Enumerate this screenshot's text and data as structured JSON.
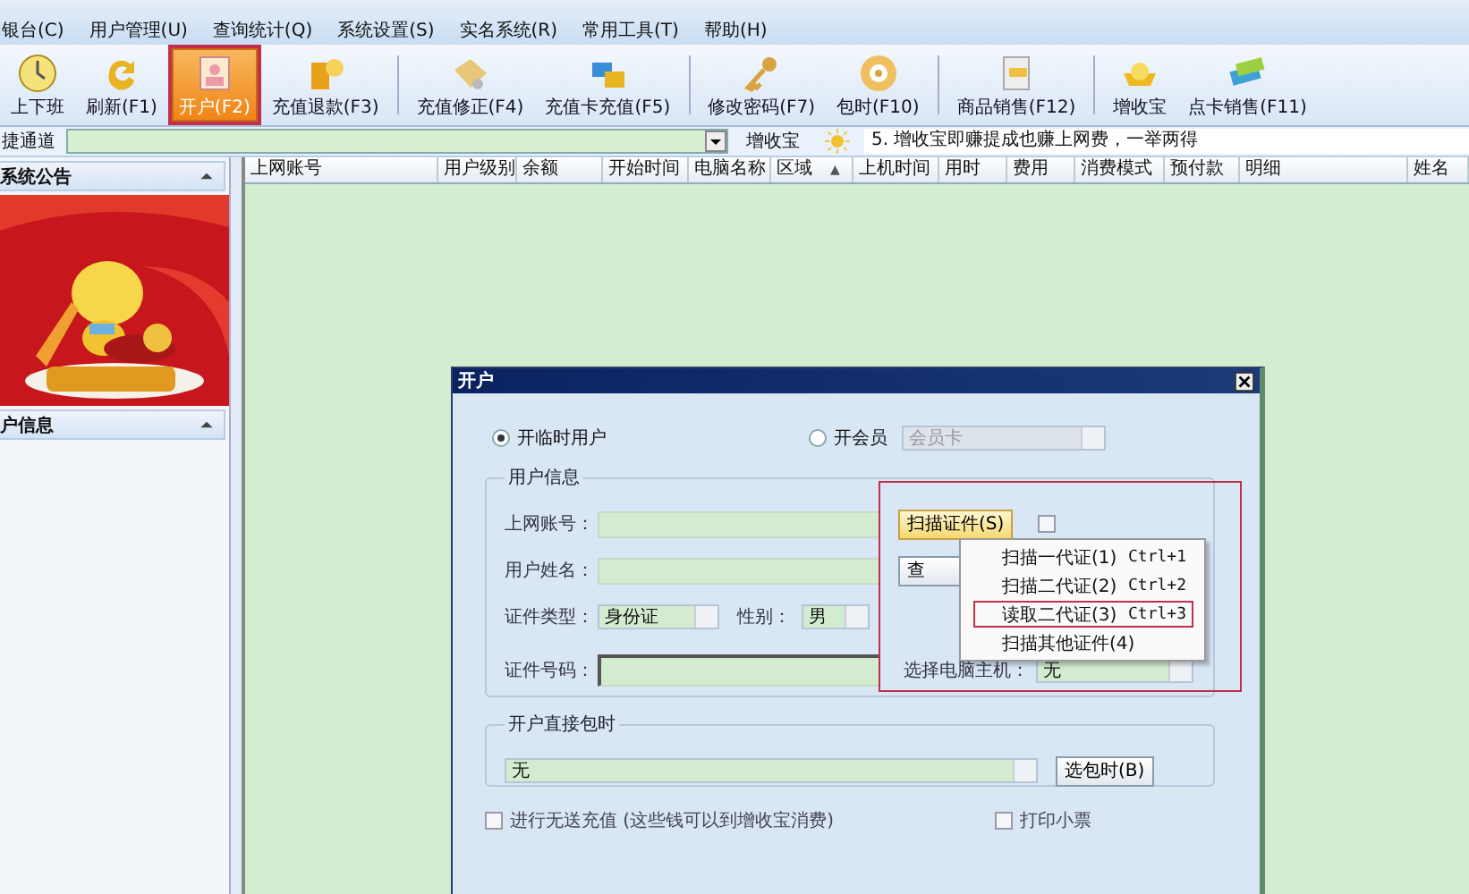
{
  "menu_bar": [
    "银台(C)",
    "用户管理(U)",
    "查询统计(Q)",
    "系统设置(S)",
    "实名系统(R)",
    "常用工具(T)",
    "帮助(H)"
  ],
  "toolbar": [
    {
      "label": "上下班",
      "selected": false,
      "marked": false,
      "separator": false
    },
    {
      "label": "刷新(F1)",
      "selected": false,
      "marked": false,
      "separator": false
    },
    {
      "label": "开户(F2)",
      "selected": true,
      "marked": true,
      "separator": false
    },
    {
      "label": "充值退款(F3)",
      "selected": false,
      "marked": false,
      "separator": false
    },
    {
      "label": "充值修正(F4)",
      "selected": false,
      "marked": false,
      "separator": true
    },
    {
      "label": "充值卡充值(F5)",
      "selected": false,
      "marked": false,
      "separator": false
    },
    {
      "label": "修改密码(F7)",
      "selected": false,
      "marked": false,
      "separator": true
    },
    {
      "label": "包时(F10)",
      "selected": false,
      "marked": false,
      "separator": false
    },
    {
      "label": "商品销售(F12)",
      "selected": false,
      "marked": false,
      "separator": true
    },
    {
      "label": "增收宝",
      "selected": false,
      "marked": false,
      "separator": true
    },
    {
      "label": "点卡销售(F11)",
      "selected": false,
      "marked": false,
      "separator": false
    }
  ],
  "quick_bar": {
    "label": "捷通道",
    "promo": "增收宝",
    "notice": "5. 增收宝即赚提成也赚上网费，一举两得"
  },
  "sidebar": {
    "sections": [
      {
        "title": "系统公告",
        "expanded": true
      },
      {
        "title": "户信息",
        "expanded": true
      }
    ]
  },
  "table": {
    "columns": [
      {
        "label": "上网账号"
      },
      {
        "label": "用户级别"
      },
      {
        "label": "余额"
      },
      {
        "label": "开始时间"
      },
      {
        "label": "电脑名称"
      },
      {
        "label": "区域",
        "sort": "▲"
      },
      {
        "label": "上机时间"
      },
      {
        "label": "用时"
      },
      {
        "label": "费用"
      },
      {
        "label": "消费模式"
      },
      {
        "label": "预付款"
      },
      {
        "label": "明细"
      },
      {
        "label": "姓名"
      }
    ]
  },
  "dialog": {
    "title": "开户",
    "account_type": [
      {
        "label": "开临时用户",
        "selected": true
      },
      {
        "label": "开会员",
        "selected": false,
        "combo": {
          "value": "会员卡",
          "disabled": true
        }
      }
    ],
    "user_info": {
      "legend": "用户信息",
      "marked": true,
      "account": {
        "label": "上网账号："
      },
      "name": {
        "label": "用户姓名："
      },
      "id_type": {
        "label": "证件类型：",
        "value": "身份证"
      },
      "gender": {
        "label": "性别：",
        "value": "男"
      },
      "id_number": {
        "label": "证件号码："
      },
      "scan_button": {
        "label": "扫描证件(S)",
        "highlighted": true
      },
      "query_button": {
        "label": "查"
      },
      "auto_account": {
        "checked": false
      },
      "host": {
        "label": "选择电脑主机：",
        "value": "无"
      }
    },
    "scan_menu": [
      {
        "label": "扫描一代证(1)",
        "shortcut": "Ctrl+1",
        "marked": false
      },
      {
        "label": "扫描二代证(2)",
        "shortcut": "Ctrl+2",
        "marked": false
      },
      {
        "label": "读取二代证(3)",
        "shortcut": "Ctrl+3",
        "marked": true
      },
      {
        "label": "扫描其他证件(4)",
        "marked": false
      }
    ],
    "package": {
      "legend": "开户直接包时",
      "value": "无",
      "button": "选包时(B)"
    },
    "options": [
      {
        "label": "进行无送充值 (这些钱可以到增收宝消费)",
        "checked": false
      },
      {
        "label": "打印小票",
        "checked": false
      }
    ]
  }
}
